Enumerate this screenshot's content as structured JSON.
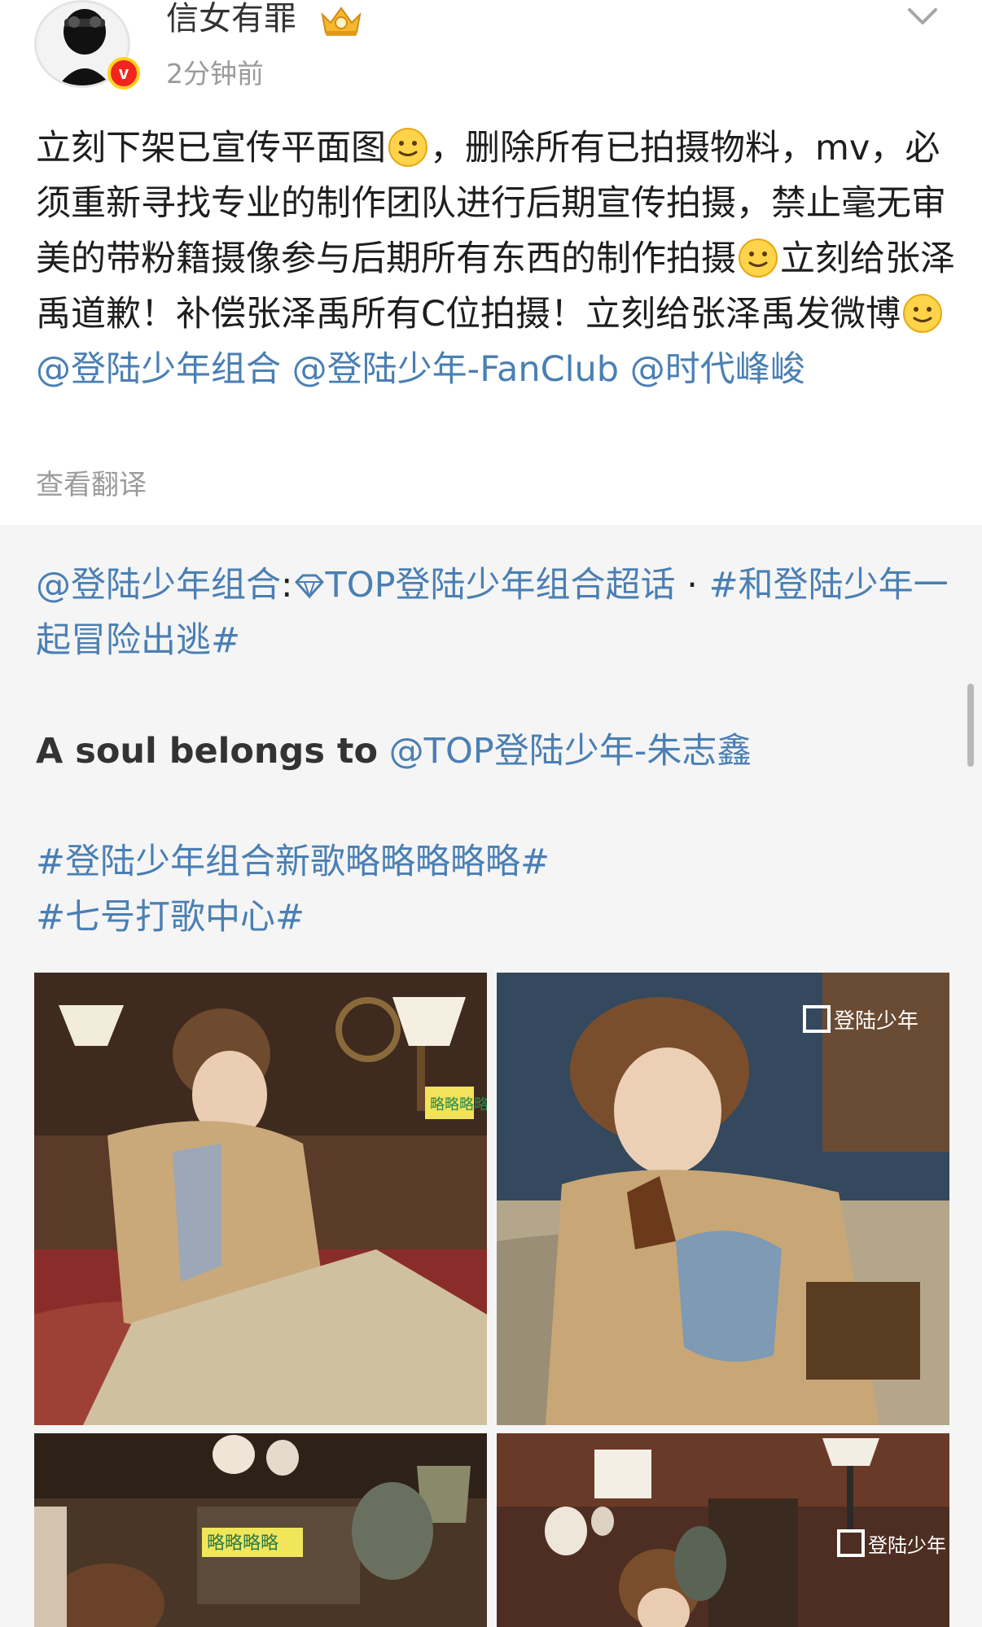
{
  "post": {
    "username": "信女有罪",
    "time": "2分钟前",
    "text": {
      "seg1": "立刻下架已宣传平面图",
      "seg2": "，删除所有已拍摄物料，mv，必须重新寻找专业的制作团队进行后期宣传拍摄，禁止毫无审美的带粉籍摄像参与后期所有东西的制作拍摄",
      "seg3": "立刻给张泽禹道歉！补偿张泽禹所有C位拍摄！立刻给张泽禹发微博",
      "mention1": "@登陆少年组合",
      "mention2": "@登陆少年-FanClub",
      "mention3": "@时代峰峻"
    },
    "translate_label": "查看翻译"
  },
  "repost": {
    "author_mention": "@登陆少年组合",
    "colon": ":",
    "supertopic": "TOP登陆少年组合超话",
    "dot": " · ",
    "hashtag1": "#和登陆少年一起冒险出逃#",
    "soul_text": "A soul belongs to",
    "member_mention": "@TOP登陆少年-朱志鑫",
    "hashtag2": "#登陆少年组合新歌略略略略略#",
    "hashtag3": "#七号打歌中心#"
  },
  "photos": {
    "logo_text": "登陆少年",
    "sticker_text": "略略略略"
  },
  "icons": {
    "crown": "crown-badge-icon",
    "verified": "verified-v-icon",
    "chevron": "chevron-down-icon",
    "emoji": "smile-emoji-icon",
    "diamond": "supertopic-diamond-icon"
  },
  "colors": {
    "link": "#4a7fb3",
    "verified_badge": "#f3241d",
    "repost_bg": "#f5f5f5"
  }
}
